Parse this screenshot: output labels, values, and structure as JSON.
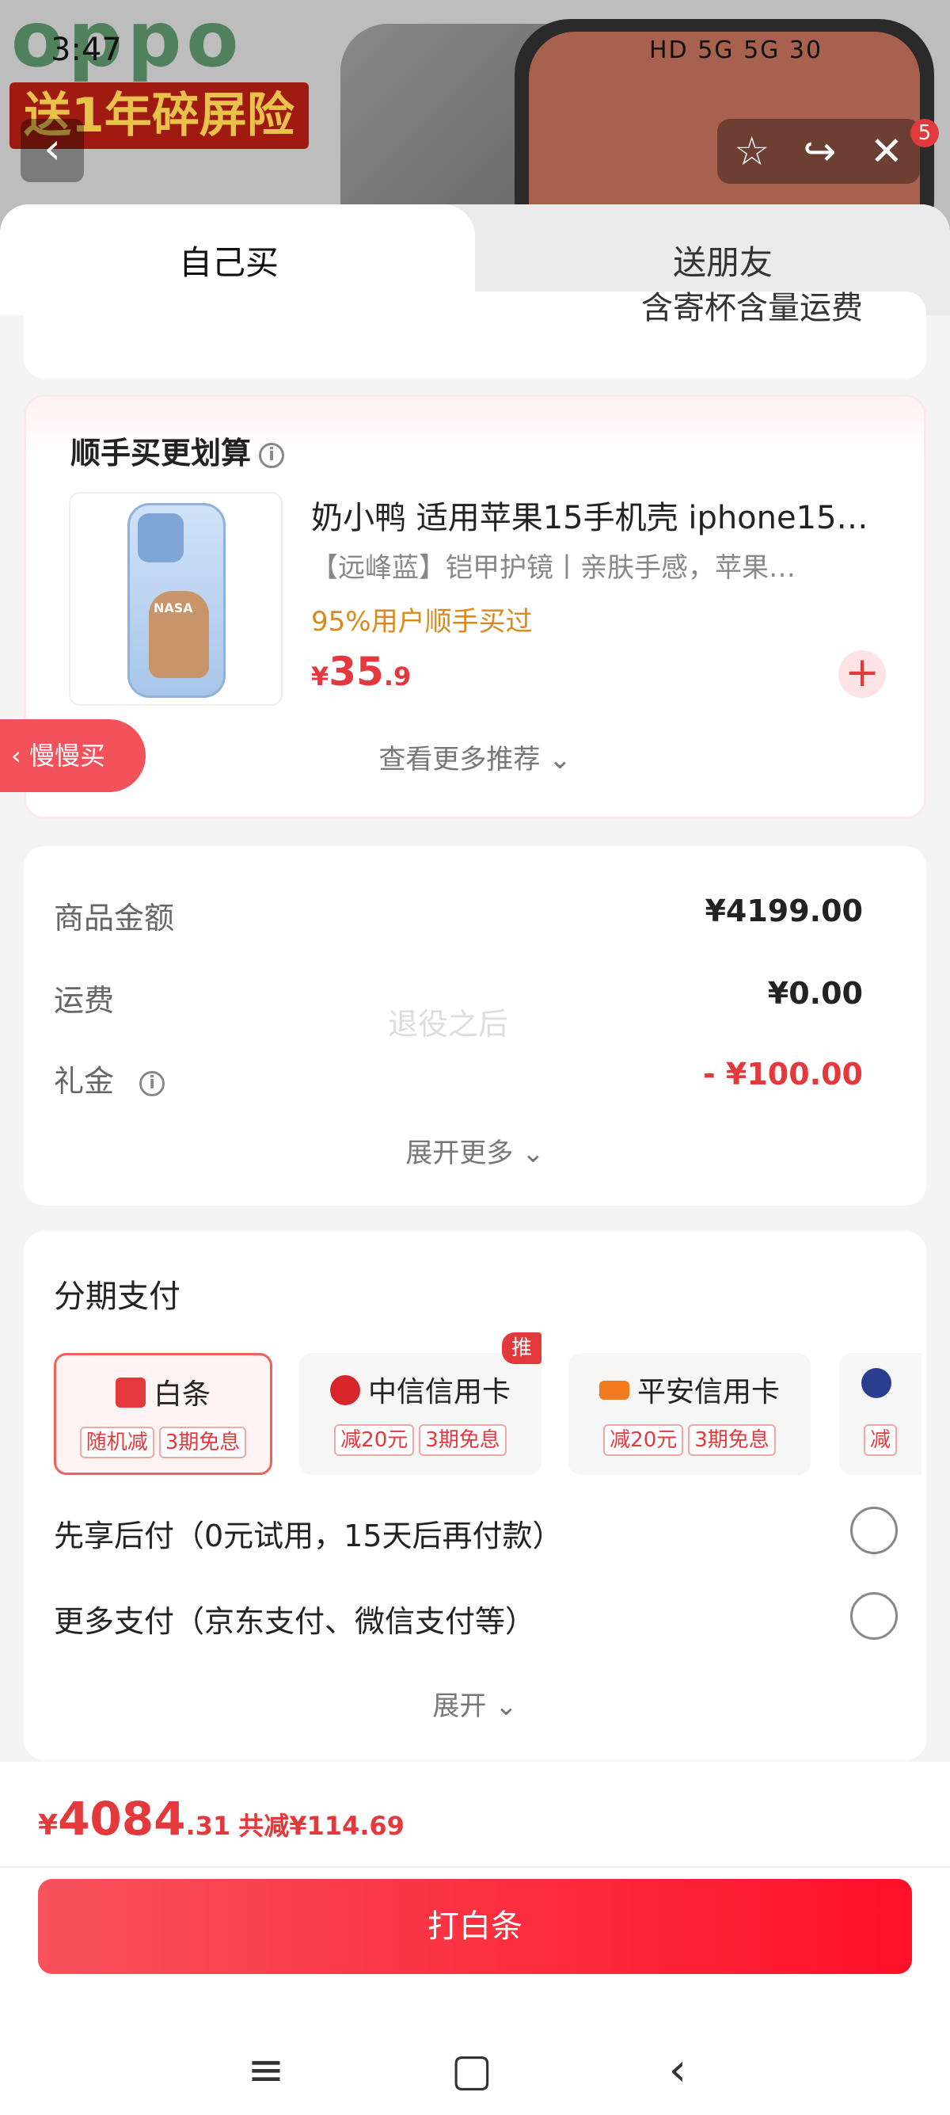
{
  "background": {
    "logo": "oppo",
    "promo": "送1年碎屏险",
    "status_time": "3:47",
    "status_right": "HD 5G 5G 30",
    "notification_count": "5"
  },
  "tabs": {
    "self": "自己买",
    "gift": "送朋友"
  },
  "cut_text": "含寄杯含量运费",
  "recommend": {
    "title": "顺手买更划算",
    "product": {
      "name": "奶小鸭 适用苹果15手机壳 iphone15…",
      "spec": "【远峰蓝】铠甲护镜丨亲肤手感，苹果…",
      "social": "95%用户顺手买过",
      "price_symbol": "¥",
      "price_int": "35",
      "price_dec": ".9",
      "image_text": "NASA"
    },
    "more": "查看更多推荐 ⌄"
  },
  "slow_buy": "慢慢买",
  "price": {
    "goods_label": "商品金额",
    "goods_value": "¥4199.00",
    "shipping_label": "运费",
    "shipping_value": "¥0.00",
    "gift_label": "礼金",
    "gift_value": "- ¥100.00",
    "watermark": "退役之后",
    "expand": "展开更多 ⌄"
  },
  "installment": {
    "title": "分期支付",
    "options": [
      {
        "name": "白条",
        "tags": [
          "随机减",
          "3期免息"
        ],
        "icon": "baitiao-icon"
      },
      {
        "name": "中信信用卡",
        "tags": [
          "减20元",
          "3期免息"
        ],
        "icon": "citic-icon",
        "badge": "推"
      },
      {
        "name": "平安信用卡",
        "tags": [
          "减20元",
          "3期免息"
        ],
        "icon": "pingan-icon"
      },
      {
        "name": "",
        "tags": [
          "减"
        ],
        "icon": "bank-icon"
      }
    ],
    "bnpl": "先享后付（0元试用，15天后再付款）",
    "more_pay": "更多支付（京东支付、微信支付等）",
    "expand": "展开 ⌄"
  },
  "bottom": {
    "total_symbol": "¥",
    "total_int": "4084",
    "total_dec": ".31",
    "saved": "共减¥114.69",
    "pay_button": "打白条"
  },
  "colors": {
    "accent": "#e4393c",
    "social": "#d98a1a"
  }
}
